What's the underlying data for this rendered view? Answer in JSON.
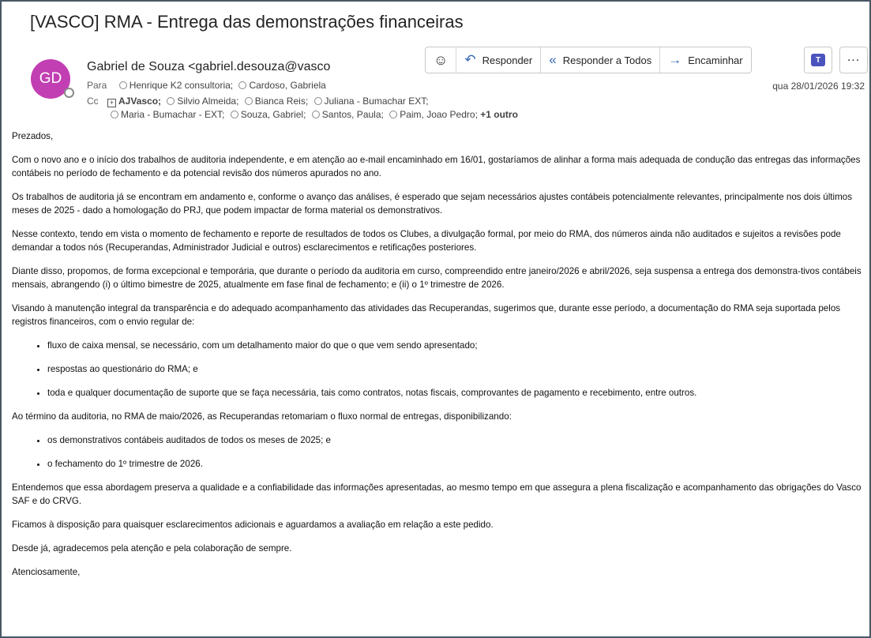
{
  "email": {
    "subject": "[VASCO] RMA - Entrega das demonstrações financeiras",
    "avatar_initials": "GD",
    "avatar_color": "#c23fb3",
    "sender": "Gabriel de Souza <gabriel.desouza@vasco",
    "to_label": "Para",
    "to": [
      "Henrique K2 consultoria;",
      "Cardoso, Gabriela"
    ],
    "cc_label": "Cc",
    "cc_group": "AJVasco;",
    "cc_line1": [
      "Silvio Almeida;",
      "Bianca Reis;",
      "Juliana - Bumachar EXT;"
    ],
    "cc_line2": [
      "Maria - Bumachar - EXT;",
      "Souza, Gabriel;",
      "Santos, Paula;",
      "Paim, Joao Pedro;"
    ],
    "cc_more": "+1 outro",
    "date": "qua 28/01/2026 19:32"
  },
  "toolbar": {
    "emoji_icon": "smiley-icon",
    "reply": "Responder",
    "reply_all": "Responder a Todos",
    "forward": "Encaminhar",
    "teams_icon": "teams-icon",
    "more_icon": "more-icon",
    "accent": "#3567b5"
  },
  "body": {
    "greeting": "Prezados,",
    "p1": "Com o novo ano e o início dos trabalhos de auditoria independente, e em atenção ao e-mail encaminhado em 16/01, gostaríamos de alinhar a forma mais adequada de condução das entregas das informações contábeis no período de fechamento e da potencial revisão dos números apurados no ano.",
    "p2": "Os trabalhos de auditoria já se encontram em andamento e, conforme o avanço das análises, é esperado que sejam necessários ajustes contábeis potencialmente relevantes, principalmente nos dois últimos meses de 2025 - dado a homologação do PRJ, que podem impactar de forma material os demonstrativos.",
    "p3": "Nesse contexto, tendo em vista o momento de fechamento e reporte de resultados de todos os Clubes, a divulgação formal, por meio do RMA, dos números ainda não auditados e sujeitos a revisões pode demandar a todos nós (Recuperandas, Administrador Judicial e outros) esclarecimentos e retificações posteriores.",
    "p4": "Diante disso, propomos, de forma excepcional e temporária, que durante o período da auditoria em curso, compreendido entre janeiro/2026 e abril/2026, seja suspensa a entrega dos demonstra-tivos contábeis mensais, abrangendo (i) o último bimestre de 2025, atualmente em fase final de fechamento; e (ii) o 1º trimestre de 2026.",
    "p5": "Visando à manutenção integral da transparência e do adequado acompanhamento das atividades das Recuperandas, sugerimos que, durante esse período, a documentação do RMA seja suportada pelos registros financeiros, com o envio regular de:",
    "list1": [
      "fluxo de caixa mensal, se necessário, com um detalhamento maior do que o que vem sendo apresentado;",
      "respostas ao questionário do RMA; e",
      "toda e qualquer documentação de suporte que se faça necessária, tais como contratos, notas fiscais, comprovantes de pagamento e recebimento, entre outros."
    ],
    "p6": "Ao término da auditoria, no RMA de maio/2026, as Recuperandas retomariam o fluxo normal de entregas, disponibilizando:",
    "list2": [
      "os demonstrativos contábeis auditados de todos os meses de 2025; e",
      "o fechamento do 1º trimestre de 2026."
    ],
    "p7": "Entendemos que essa abordagem preserva a qualidade e a confiabilidade das informações apresentadas, ao mesmo tempo em que assegura a plena fiscalização e acompanhamento das obrigações do Vasco SAF e do CRVG.",
    "p8": "Ficamos à disposição para quaisquer esclarecimentos adicionais e aguardamos a avaliação em relação a este pedido.",
    "p9": "Desde já, agradecemos pela atenção e pela colaboração de sempre.",
    "closing": "Atenciosamente,"
  }
}
